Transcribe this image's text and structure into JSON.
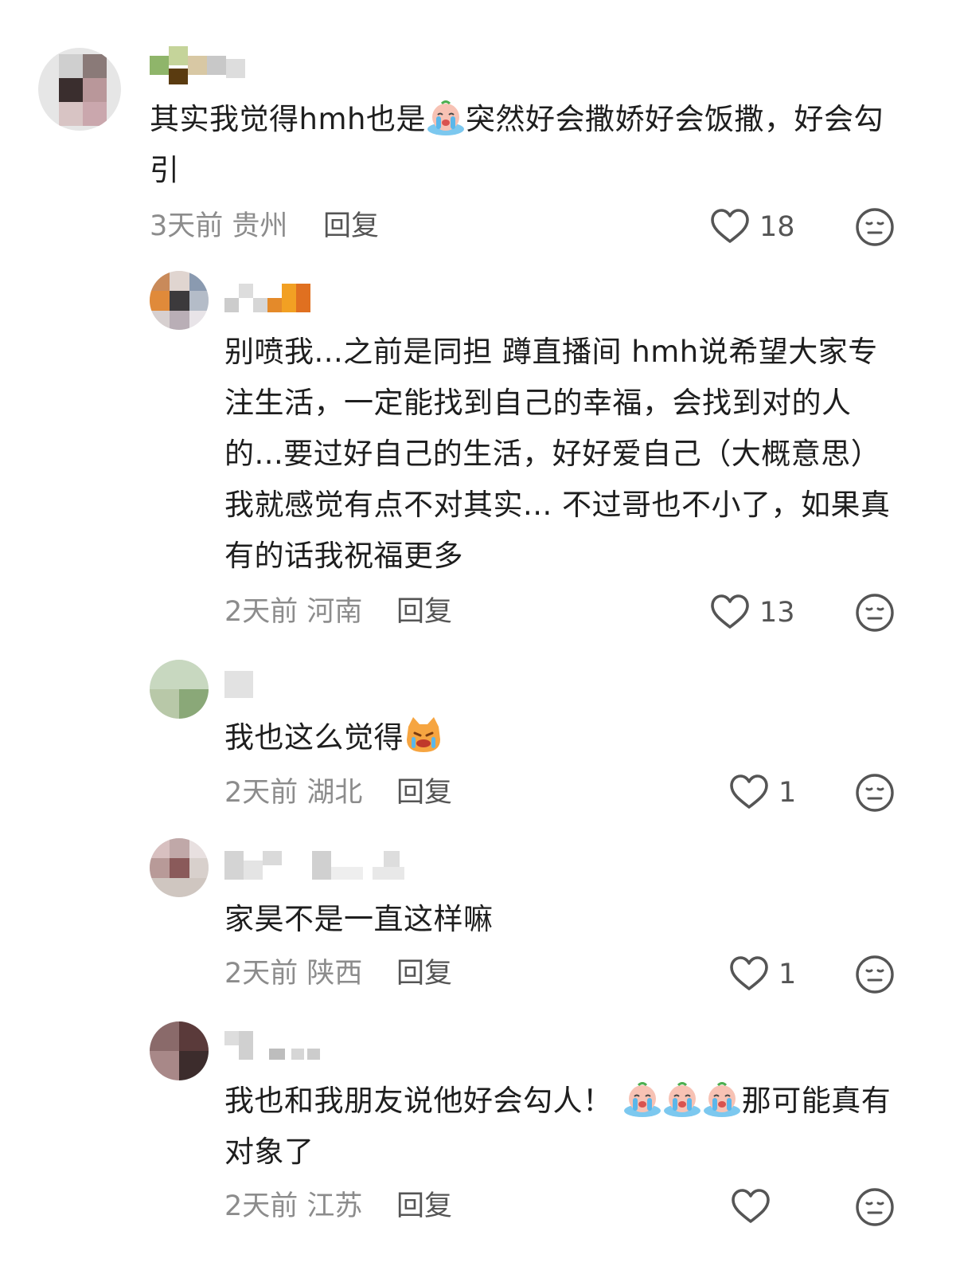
{
  "comments": [
    {
      "text_parts": [
        "其实我觉得hmh也是",
        "突然好会撒娇好会饭撒，好会勾引"
      ],
      "time": "3天前",
      "location": "贵州",
      "reply": "回复",
      "likes": "18"
    },
    {
      "text": "别喷我...之前是同担 蹲直播间 hmh说希望大家专注生活，一定能找到自己的幸福，会找到对的人的...要过好自己的生活，好好爱自己（大概意思）我就感觉有点不对其实... 不过哥也不小了，如果真有的话我祝福更多",
      "time": "2天前",
      "location": "河南",
      "reply": "回复",
      "likes": "13"
    },
    {
      "text": "我也这么觉得",
      "time": "2天前",
      "location": "湖北",
      "reply": "回复",
      "likes": "1"
    },
    {
      "text": "家昊不是一直这样嘛",
      "time": "2天前",
      "location": "陕西",
      "reply": "回复",
      "likes": "1"
    },
    {
      "text_parts": [
        "我也和我朋友说他好会勾人！ ",
        "那可能真有对象了"
      ],
      "time": "2天前",
      "location": "江苏",
      "reply": "回复",
      "likes": ""
    }
  ],
  "icons": {
    "like": "heart-outline-icon",
    "dislike": "neutral-face-icon",
    "crying_emoji": "crying-face-emoji",
    "cat_emoji": "crying-cat-emoji"
  },
  "colors": {
    "text": "#1e1e1e",
    "meta": "#8c8c8c",
    "reply": "#555555",
    "icon": "#555555"
  }
}
